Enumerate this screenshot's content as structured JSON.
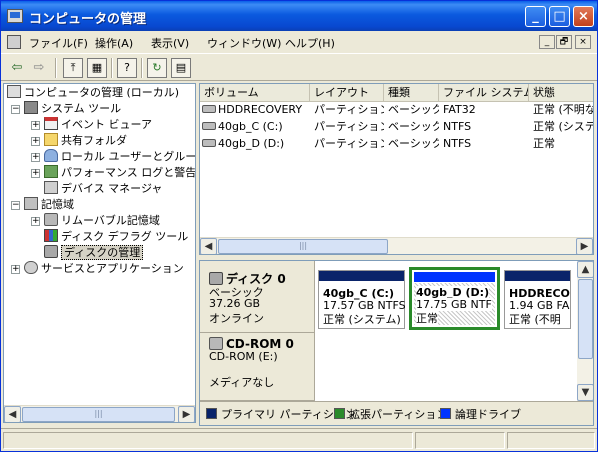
{
  "window": {
    "title": "コンピュータの管理"
  },
  "title_buttons": [
    "_",
    "□",
    "×"
  ],
  "menu": {
    "items": [
      "ファイル(F)",
      "操作(A)",
      "表示(V)",
      "ウィンドウ(W)",
      "ヘルプ(H)"
    ],
    "mdi_controls": [
      "_",
      "🗗",
      "×"
    ]
  },
  "toolbar": {
    "buttons": [
      {
        "icon": "back-arrow-icon",
        "glyph": "⇦"
      },
      {
        "icon": "forward-arrow-icon",
        "glyph": "⇨"
      },
      {
        "icon": "up-folder-icon",
        "glyph": "⤒"
      },
      {
        "icon": "show-hide-tree-icon",
        "glyph": "▦"
      },
      {
        "icon": "properties-icon",
        "glyph": "?"
      },
      {
        "icon": "refresh-icon",
        "glyph": "↻"
      },
      {
        "icon": "export-list-icon",
        "glyph": "▤"
      }
    ]
  },
  "tree": {
    "root": "コンピュータの管理 (ローカル)",
    "nodes": [
      {
        "label": "システム ツール",
        "pm": "−",
        "icon": "tool"
      },
      {
        "label": "イベント ビューア",
        "pm": "+",
        "icon": "event"
      },
      {
        "label": "共有フォルダ",
        "pm": "+",
        "icon": "folder"
      },
      {
        "label": "ローカル ユーザーとグループ",
        "pm": "+",
        "icon": "users"
      },
      {
        "label": "パフォーマンス ログと警告",
        "pm": "+",
        "icon": "perf"
      },
      {
        "label": "デバイス マネージャ",
        "pm": "",
        "icon": "dev"
      },
      {
        "label": "記憶域",
        "pm": "−",
        "icon": "storage"
      },
      {
        "label": "リムーバブル記憶域",
        "pm": "+",
        "icon": "rem"
      },
      {
        "label": "ディスク デフラグ ツール",
        "pm": "",
        "icon": "defrag"
      },
      {
        "label": "ディスクの管理",
        "pm": "",
        "icon": "disk"
      },
      {
        "label": "サービスとアプリケーション",
        "pm": "+",
        "icon": "svc"
      }
    ]
  },
  "volumes": {
    "columns": [
      "ボリューム",
      "レイアウト",
      "種類",
      "ファイル システム",
      "状態"
    ],
    "rows": [
      [
        "HDDRECOVERY",
        "パーティション",
        "ベーシック",
        "FAT32",
        "正常 (不明な"
      ],
      [
        "40gb_C (C:)",
        "パーティション",
        "ベーシック",
        "NTFS",
        "正常 (システム"
      ],
      [
        "40gb_D (D:)",
        "パーティション",
        "ベーシック",
        "NTFS",
        "正常"
      ]
    ]
  },
  "disks": [
    {
      "name": "ディスク 0",
      "type": "ベーシック",
      "size": "37.26 GB",
      "status": "オンライン",
      "partitions": [
        {
          "name": "40gb_C (C:)",
          "size": "17.57 GB NTFS",
          "status": "正常 (システム)",
          "color": "#0a246a"
        },
        {
          "name": "40gb_D (D:)",
          "size": "17.75 GB NTF",
          "status": "正常",
          "color": "#0033ff"
        },
        {
          "name": "HDDRECO",
          "size": "1.94 GB FA",
          "status": "正常 (不明",
          "color": "#0a246a"
        }
      ]
    },
    {
      "name": "CD-ROM 0",
      "type": "CD-ROM (E:)",
      "status": "メディアなし"
    }
  ],
  "legend": [
    {
      "label": "プライマリ パーティション",
      "color": "#0a246a"
    },
    {
      "label": "拡張パーティション",
      "color": "#2a8a2a"
    },
    {
      "label": "論理ドライブ",
      "color": "#0033ff"
    }
  ],
  "colors": {
    "selected_partition_border": "#2a8a2a",
    "title_bar": "#0a5fe8"
  }
}
